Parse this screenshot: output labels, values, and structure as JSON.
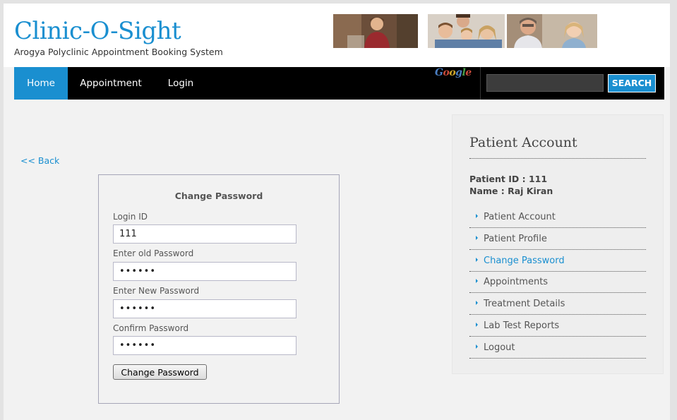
{
  "brand": {
    "title": "Clinic-O-Sight",
    "subtitle": "Arogya Polyclinic Appointment Booking System"
  },
  "nav": {
    "items": [
      {
        "label": "Home",
        "active": true
      },
      {
        "label": "Appointment",
        "active": false
      },
      {
        "label": "Login",
        "active": false
      }
    ],
    "google_logo": "Google",
    "search": {
      "value": "",
      "placeholder": "",
      "button_label": "SEARCH"
    }
  },
  "back_link": "<< Back",
  "form": {
    "title": "Change Password",
    "fields": [
      {
        "label": "Login ID",
        "value": "111",
        "type": "text"
      },
      {
        "label": "Enter old Password",
        "value": "••••••",
        "type": "password"
      },
      {
        "label": "Enter New Password",
        "value": "••••••",
        "type": "password"
      },
      {
        "label": "Confirm Password",
        "value": "••••••",
        "type": "password"
      }
    ],
    "submit_label": "Change Password"
  },
  "sidebar": {
    "title": "Patient Account",
    "patient_id": "Patient ID : 111",
    "patient_name": "Name : Raj Kiran",
    "items": [
      {
        "label": "Patient Account",
        "active": false
      },
      {
        "label": "Patient Profile",
        "active": false
      },
      {
        "label": "Change Password",
        "active": true
      },
      {
        "label": "Appointments",
        "active": false
      },
      {
        "label": "Treatment Details",
        "active": false
      },
      {
        "label": "Lab Test Reports",
        "active": false
      },
      {
        "label": "Logout",
        "active": false
      }
    ]
  },
  "colors": {
    "accent": "#1a8fd0",
    "navbar": "#000000",
    "page_bg": "#f2f2f2"
  },
  "images": [
    "nurse-photo",
    "family-photo",
    "child-dentist-photo"
  ]
}
